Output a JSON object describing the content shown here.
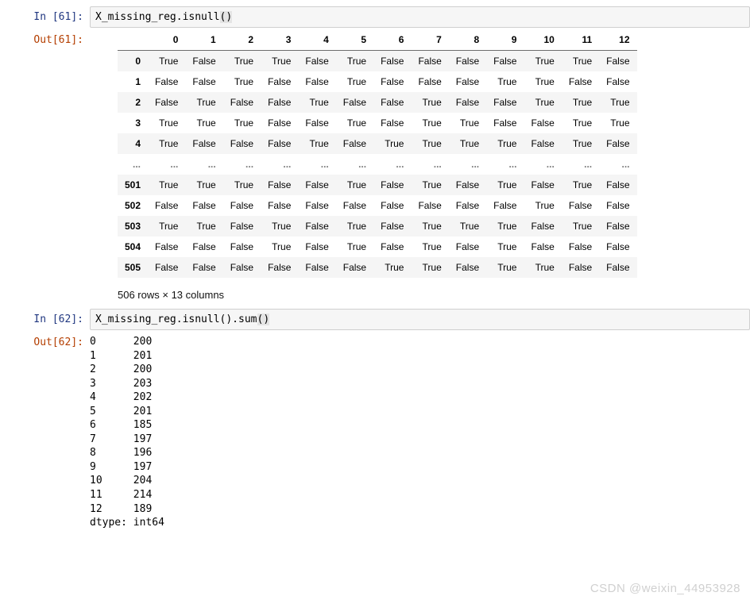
{
  "cells": [
    {
      "kind": "in",
      "prompt": "In [61]:",
      "code_plain": "X_missing_reg.isnull",
      "code_highlight": "()"
    },
    {
      "kind": "out",
      "prompt": "Out[61]:",
      "dataframe": {
        "columns": [
          "0",
          "1",
          "2",
          "3",
          "4",
          "5",
          "6",
          "7",
          "8",
          "9",
          "10",
          "11",
          "12"
        ],
        "index": [
          "0",
          "1",
          "2",
          "3",
          "4",
          "...",
          "501",
          "502",
          "503",
          "504",
          "505"
        ],
        "rows": [
          [
            "True",
            "False",
            "True",
            "True",
            "False",
            "True",
            "False",
            "False",
            "False",
            "False",
            "True",
            "True",
            "False"
          ],
          [
            "False",
            "False",
            "True",
            "False",
            "False",
            "True",
            "False",
            "False",
            "False",
            "True",
            "True",
            "False",
            "False"
          ],
          [
            "False",
            "True",
            "False",
            "False",
            "True",
            "False",
            "False",
            "True",
            "False",
            "False",
            "True",
            "True",
            "True"
          ],
          [
            "True",
            "True",
            "True",
            "False",
            "False",
            "True",
            "False",
            "True",
            "True",
            "False",
            "False",
            "True",
            "True"
          ],
          [
            "True",
            "False",
            "False",
            "False",
            "True",
            "False",
            "True",
            "True",
            "True",
            "True",
            "False",
            "True",
            "False"
          ],
          [
            "...",
            "...",
            "...",
            "...",
            "...",
            "...",
            "...",
            "...",
            "...",
            "...",
            "...",
            "...",
            "..."
          ],
          [
            "True",
            "True",
            "True",
            "False",
            "False",
            "True",
            "False",
            "True",
            "False",
            "True",
            "False",
            "True",
            "False"
          ],
          [
            "False",
            "False",
            "False",
            "False",
            "False",
            "False",
            "False",
            "False",
            "False",
            "False",
            "True",
            "False",
            "False"
          ],
          [
            "True",
            "True",
            "False",
            "True",
            "False",
            "True",
            "False",
            "True",
            "True",
            "True",
            "False",
            "True",
            "False"
          ],
          [
            "False",
            "False",
            "False",
            "True",
            "False",
            "True",
            "False",
            "True",
            "False",
            "True",
            "False",
            "False",
            "False"
          ],
          [
            "False",
            "False",
            "False",
            "False",
            "False",
            "False",
            "True",
            "True",
            "False",
            "True",
            "True",
            "False",
            "False"
          ]
        ],
        "meta": "506 rows × 13 columns"
      }
    },
    {
      "kind": "in",
      "prompt": "In [62]:",
      "code_plain": "X_missing_reg.isnull().sum",
      "code_highlight": "()"
    },
    {
      "kind": "out",
      "prompt": "Out[62]:",
      "text": "0      200\n1      201\n2      200\n3      203\n4      202\n5      201\n6      185\n7      197\n8      196\n9      197\n10     204\n11     214\n12     189\ndtype: int64"
    }
  ],
  "watermark": "CSDN @weixin_44953928"
}
